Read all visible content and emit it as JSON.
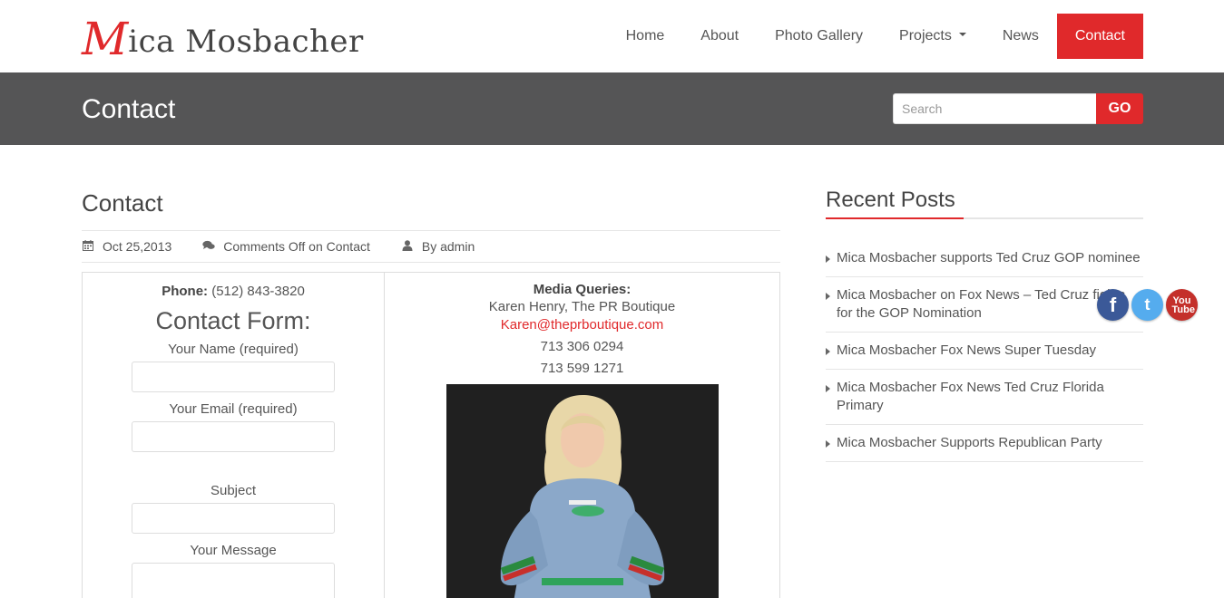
{
  "header": {
    "logo_initial": "M",
    "logo_rest": "ica Mosbacher",
    "nav": [
      {
        "label": "Home"
      },
      {
        "label": "About"
      },
      {
        "label": "Photo Gallery"
      },
      {
        "label": "Projects"
      },
      {
        "label": "News"
      },
      {
        "label": "Contact"
      }
    ]
  },
  "band": {
    "title": "Contact",
    "search_placeholder": "Search",
    "search_button": "GO"
  },
  "post": {
    "title": "Contact",
    "meta": {
      "date": "Oct 25,2013",
      "comments": "Comments Off on Contact",
      "author": "By admin"
    },
    "left": {
      "phone_label": "Phone:",
      "phone_value": "(512) 843-3820",
      "form_heading": "Contact Form:",
      "name_label": "Your Name (required)",
      "email_label": "Your Email (required)",
      "subject_label": "Subject",
      "message_label": "Your Message"
    },
    "right": {
      "media_title": "Media Queries:",
      "contact_name": "Karen Henry, The PR Boutique",
      "contact_email": "Karen@theprboutique.com",
      "phone1": "713 306 0294",
      "phone2": "713 599 1271"
    }
  },
  "sidebar": {
    "title": "Recent Posts",
    "posts": [
      {
        "title": "Mica Mosbacher supports Ted Cruz GOP nominee"
      },
      {
        "title": "Mica Mosbacher on Fox News – Ted Cruz fights for the GOP Nomination"
      },
      {
        "title": "Mica Mosbacher Fox News Super Tuesday"
      },
      {
        "title": "Mica Mosbacher Fox News Ted Cruz Florida Primary"
      },
      {
        "title": "Mica Mosbacher Supports Republican Party"
      }
    ]
  },
  "social": {
    "facebook_glyph": "f",
    "twitter_glyph": "t",
    "youtube_glyph": "You Tube"
  },
  "colors": {
    "accent": "#e0292b",
    "band": "#555556"
  }
}
